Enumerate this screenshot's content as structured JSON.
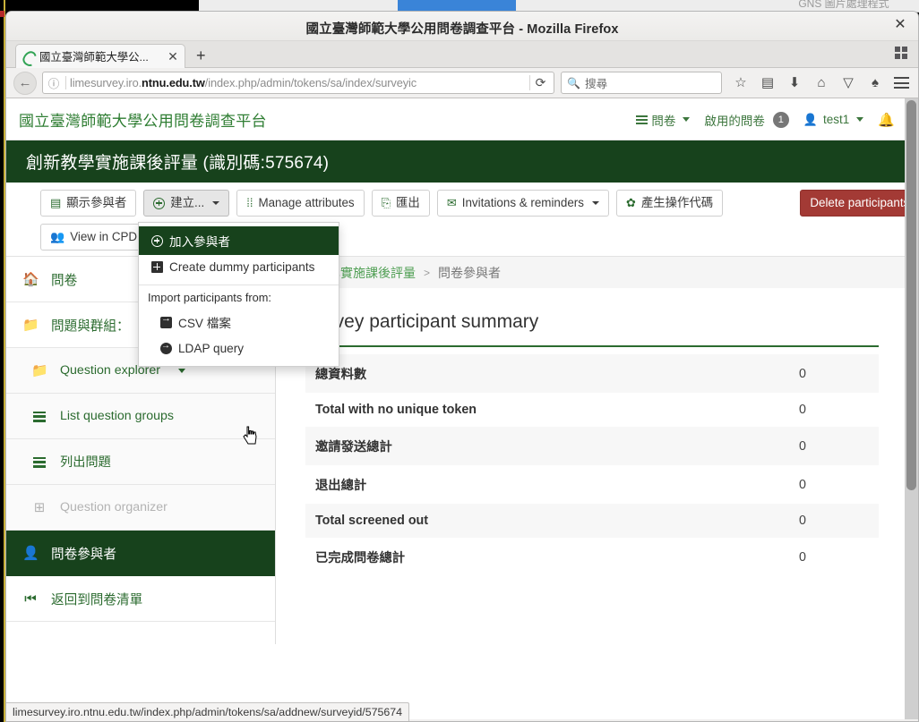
{
  "background_windows": {
    "title_partial": "GNS 圖片處理程式",
    "minimize_glyph": "—"
  },
  "browser": {
    "window_title": "國立臺灣師範大學公用問卷調查平台 - Mozilla Firefox",
    "close_glyph": "✕",
    "tab": {
      "title": "國立臺灣師範大學公...",
      "close_glyph": "✕"
    },
    "new_tab_glyph": "+",
    "back_glyph": "←",
    "info_glyph": "ⓘ",
    "url_prefix": "limesurvey.iro.",
    "url_domain": "ntnu.edu.tw",
    "url_suffix": "/index.php/admin/tokens/sa/index/surveyic",
    "reload_glyph": "⟳",
    "search_placeholder": "搜尋",
    "search_glyph": "🔍",
    "toolbar_icons": [
      "star-icon",
      "library-icon",
      "download-icon",
      "home-icon",
      "pocket-icon",
      "sync-icon"
    ],
    "status_url": "limesurvey.iro.ntnu.edu.tw/index.php/admin/tokens/sa/addnew/surveyid/575674"
  },
  "app": {
    "brand": "國立臺灣師範大學公用問卷調查平台",
    "nav": {
      "surveys_label": "問卷",
      "active_surveys_label": "啟用的問卷",
      "active_surveys_count": "1",
      "user_label": "test1",
      "bell_glyph": "🔔"
    },
    "survey_title": "創新教學實施課後評量 (識別碼:575674)",
    "toolbar": {
      "show_participants": "顯示參與者",
      "create": "建立...",
      "manage_attributes": "Manage attributes",
      "export": "匯出",
      "invitations": "Invitations & reminders",
      "generate_codes": "產生操作代碼",
      "delete_table": "Delete participants table",
      "view_in_cpdb": "View in CPDB"
    },
    "dropdown": {
      "add_participant": "加入參與者",
      "create_dummy": "Create dummy participants",
      "import_header": "Import participants from:",
      "csv": "CSV 檔案",
      "ldap": "LDAP query"
    },
    "sidebar": [
      {
        "label": "問卷",
        "icon": "home-icon",
        "state": "normal",
        "sub": false,
        "caret": false
      },
      {
        "label": "問題與群組：",
        "icon": "folder-icon",
        "state": "normal",
        "sub": false,
        "caret": false
      },
      {
        "label": "Question explorer",
        "icon": "folder-icon",
        "state": "normal",
        "sub": true,
        "caret": true
      },
      {
        "label": "List question groups",
        "icon": "list-icon",
        "state": "normal",
        "sub": true,
        "caret": false
      },
      {
        "label": "列出問題",
        "icon": "list-icon",
        "state": "normal",
        "sub": true,
        "caret": false
      },
      {
        "label": "Question organizer",
        "icon": "organizer-icon",
        "state": "disabled",
        "sub": true,
        "caret": false
      },
      {
        "label": "問卷參與者",
        "icon": "person-icon",
        "state": "selected",
        "sub": false,
        "caret": false
      },
      {
        "label": "返回到問卷清單",
        "icon": "back-to-list-icon",
        "state": "normal",
        "sub": false,
        "caret": false
      }
    ],
    "breadcrumb": {
      "link": "新教學實施課後評量",
      "separator": ">",
      "current": "問卷參與者"
    },
    "panel": {
      "title": "Survey participant summary",
      "rows": [
        {
          "key": "總資料數",
          "value": "0"
        },
        {
          "key": "Total with no unique token",
          "value": "0"
        },
        {
          "key": "邀請發送總計",
          "value": "0"
        },
        {
          "key": "退出總計",
          "value": "0"
        },
        {
          "key": "Total screened out",
          "value": "0"
        },
        {
          "key": "已完成問卷總計",
          "value": "0"
        }
      ]
    }
  },
  "colors": {
    "brand_green": "#2e7d32",
    "dark_green": "#17421c",
    "link_green": "#4e9e52",
    "danger_red": "#a33a35"
  }
}
